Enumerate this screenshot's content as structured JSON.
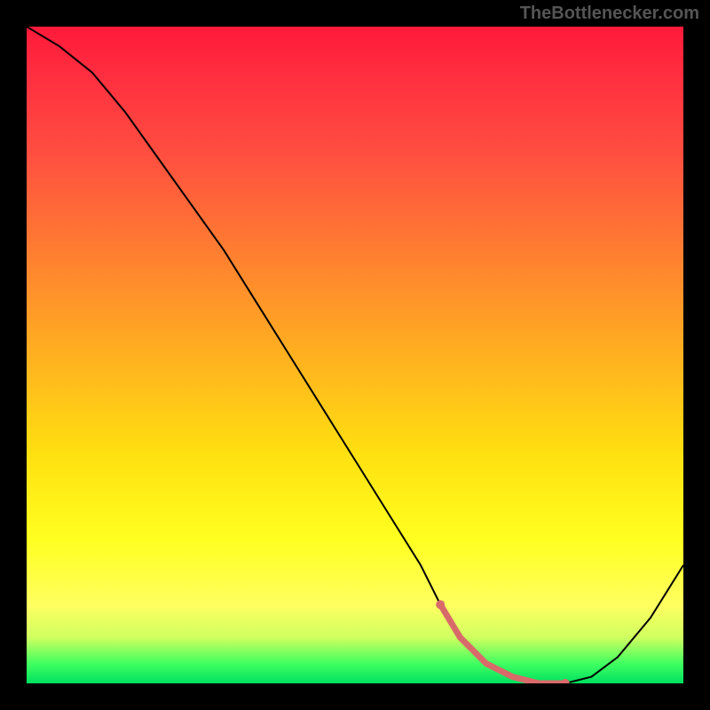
{
  "watermark": "TheBottlenecker.com",
  "chart_data": {
    "type": "line",
    "title": "",
    "xlabel": "",
    "ylabel": "",
    "xlim": [
      0,
      100
    ],
    "ylim": [
      0,
      100
    ],
    "series": [
      {
        "name": "curve",
        "x": [
          0,
          5,
          10,
          15,
          20,
          25,
          30,
          35,
          40,
          45,
          50,
          55,
          60,
          63,
          66,
          70,
          74,
          78,
          82,
          86,
          90,
          95,
          100
        ],
        "values": [
          100,
          97,
          93,
          87,
          80,
          73,
          66,
          58,
          50,
          42,
          34,
          26,
          18,
          12,
          7,
          3,
          1,
          0,
          0,
          1,
          4,
          10,
          18
        ]
      }
    ],
    "marker_region": {
      "x_start": 63,
      "x_end": 82,
      "color": "#d86a6a"
    },
    "gradient_stops": [
      {
        "pos": 0,
        "color": "#ff1a3a"
      },
      {
        "pos": 50,
        "color": "#ffd020"
      },
      {
        "pos": 95,
        "color": "#ffff60"
      },
      {
        "pos": 100,
        "color": "#00e060"
      }
    ]
  }
}
